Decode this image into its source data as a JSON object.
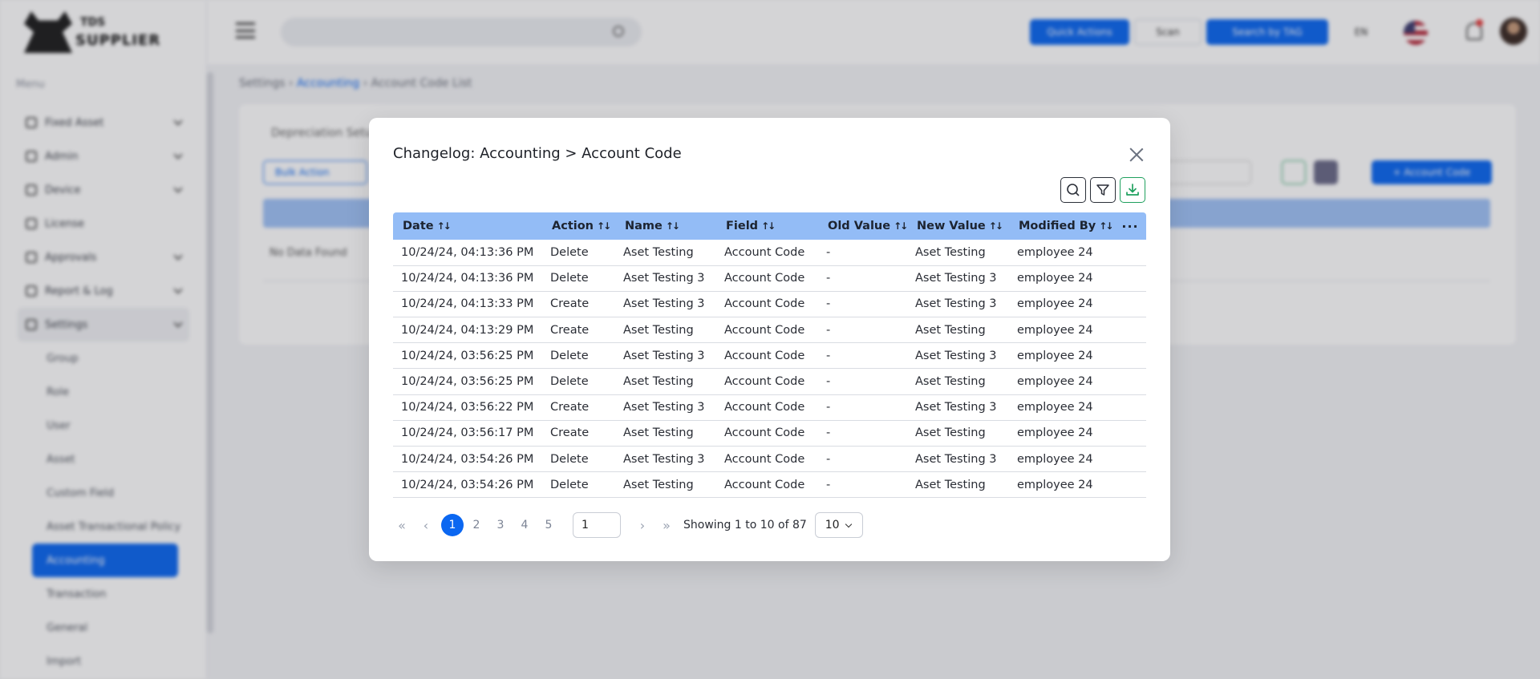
{
  "app": {
    "logo_line1": "TDS",
    "logo_line2": "SUPPLIER",
    "menu_title": "Menu",
    "nav": [
      {
        "label": "Fixed Asset"
      },
      {
        "label": "Admin"
      },
      {
        "label": "Device"
      },
      {
        "label": "License"
      },
      {
        "label": "Approvals"
      },
      {
        "label": "Report & Log"
      },
      {
        "label": "Settings"
      }
    ],
    "settings_sub": [
      "Group",
      "Role",
      "User",
      "Asset",
      "Custom Field",
      "Asset Transactional Policy",
      "Accounting",
      "Transaction",
      "General",
      "Import"
    ],
    "topbar": {
      "btn1": "Quick Actions",
      "btn2": "Scan",
      "btn3": "Search by TAG",
      "lang": "EN"
    },
    "breadcrumb": [
      "Settings",
      "Accounting",
      "Account Code List"
    ],
    "card": {
      "tab": "Depreciation Setup",
      "bulk": "Bulk Action",
      "no_data": "No Data Found",
      "add": "+ Account Code"
    }
  },
  "modal": {
    "title": "Changelog: Accounting > Account Code",
    "tools": [
      "search-icon",
      "filter-icon",
      "download-icon"
    ],
    "columns": [
      "Date",
      "Action",
      "Name",
      "Field",
      "Old Value",
      "New Value",
      "Modified By"
    ],
    "more": "···",
    "rows": [
      [
        "10/24/24, 04:13:36 PM",
        "Delete",
        "Aset Testing",
        "Account Code",
        "-",
        "Aset Testing",
        "employee 24"
      ],
      [
        "10/24/24, 04:13:36 PM",
        "Delete",
        "Aset Testing 3",
        "Account Code",
        "-",
        "Aset Testing 3",
        "employee 24"
      ],
      [
        "10/24/24, 04:13:33 PM",
        "Create",
        "Aset Testing 3",
        "Account Code",
        "-",
        "Aset Testing 3",
        "employee 24"
      ],
      [
        "10/24/24, 04:13:29 PM",
        "Create",
        "Aset Testing",
        "Account Code",
        "-",
        "Aset Testing",
        "employee 24"
      ],
      [
        "10/24/24, 03:56:25 PM",
        "Delete",
        "Aset Testing 3",
        "Account Code",
        "-",
        "Aset Testing 3",
        "employee 24"
      ],
      [
        "10/24/24, 03:56:25 PM",
        "Delete",
        "Aset Testing",
        "Account Code",
        "-",
        "Aset Testing",
        "employee 24"
      ],
      [
        "10/24/24, 03:56:22 PM",
        "Create",
        "Aset Testing 3",
        "Account Code",
        "-",
        "Aset Testing 3",
        "employee 24"
      ],
      [
        "10/24/24, 03:56:17 PM",
        "Create",
        "Aset Testing",
        "Account Code",
        "-",
        "Aset Testing",
        "employee 24"
      ],
      [
        "10/24/24, 03:54:26 PM",
        "Delete",
        "Aset Testing 3",
        "Account Code",
        "-",
        "Aset Testing 3",
        "employee 24"
      ],
      [
        "10/24/24, 03:54:26 PM",
        "Delete",
        "Aset Testing",
        "Account Code",
        "-",
        "Aset Testing",
        "employee 24"
      ]
    ],
    "pagination": {
      "first": "«",
      "prev": "‹",
      "pages": [
        "1",
        "2",
        "3",
        "4",
        "5"
      ],
      "active_page": "1",
      "next": "›",
      "last": "»",
      "goto_value": "1",
      "info": "Showing 1 to 10 of 87",
      "page_size": "10"
    }
  },
  "colors": {
    "primary": "#0b67f1",
    "header_row": "#93bcf6",
    "download_green": "#1fa05e"
  }
}
